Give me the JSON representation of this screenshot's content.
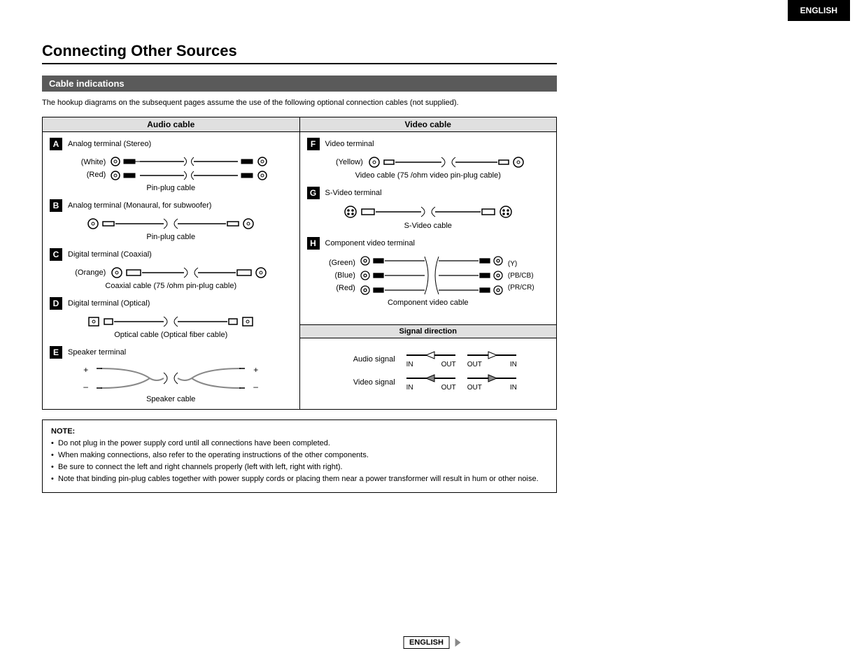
{
  "header": {
    "lang_tab": "ENGLISH",
    "title": "Connecting Other Sources"
  },
  "section": {
    "bar": "Cable indications",
    "intro": "The hookup diagrams on the subsequent pages assume the use of the following optional connection cables (not supplied)."
  },
  "table": {
    "audio_header": "Audio cable",
    "video_header": "Video cable",
    "signal_header": "Signal direction"
  },
  "audio": {
    "A": {
      "badge": "A",
      "name": "Analog terminal (Stereo)",
      "white": "(White)",
      "red": "(Red)",
      "caption": "Pin-plug cable"
    },
    "B": {
      "badge": "B",
      "name": "Analog terminal (Monaural, for subwoofer)",
      "caption": "Pin-plug cable"
    },
    "C": {
      "badge": "C",
      "name": "Digital terminal (Coaxial)",
      "orange": "(Orange)",
      "caption": "Coaxial cable (75    /ohm pin-plug cable)"
    },
    "D": {
      "badge": "D",
      "name": "Digital terminal (Optical)",
      "caption": "Optical cable (Optical fiber cable)"
    },
    "E": {
      "badge": "E",
      "name": "Speaker terminal",
      "plus": "+",
      "minus": "–",
      "caption": "Speaker cable"
    }
  },
  "video": {
    "F": {
      "badge": "F",
      "name": "Video terminal",
      "yellow": "(Yellow)",
      "caption": "Video cable (75    /ohm video pin-plug cable)"
    },
    "G": {
      "badge": "G",
      "name": "S-Video terminal",
      "caption": "S-Video cable"
    },
    "H": {
      "badge": "H",
      "name": "Component video terminal",
      "green": "(Green)",
      "blue": "(Blue)",
      "red": "(Red)",
      "y": "(Y)",
      "pb": "(PB/CB)",
      "pr": "(PR/CR)",
      "caption": "Component video cable"
    }
  },
  "signal": {
    "audio": "Audio signal",
    "video": "Video signal",
    "in": "IN",
    "out": "OUT"
  },
  "note": {
    "title": "NOTE:",
    "items": [
      "Do not plug in the power supply cord until all connections have been completed.",
      "When making connections, also refer to the operating instructions of the other components.",
      "Be sure to connect the left and right channels properly (left with left, right with right).",
      "Note that binding pin-plug cables together with power supply cords or placing them near a power transformer will result in hum or other noise."
    ]
  },
  "footer": {
    "lang": "ENGLISH"
  }
}
